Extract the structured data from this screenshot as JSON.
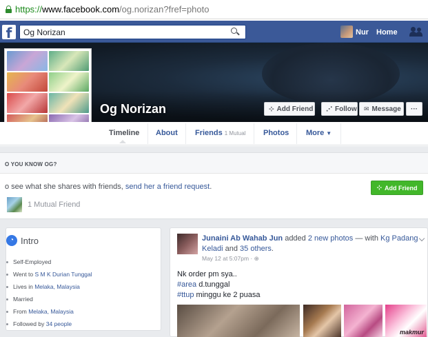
{
  "browser": {
    "url_scheme": "https://",
    "url_host": "www.facebook.com",
    "url_path": "/og.norizan?fref=photo"
  },
  "topbar": {
    "logo": "f",
    "search_value": "Og Norizan",
    "user_name": "Nur",
    "home_label": "Home"
  },
  "profile": {
    "name": "Og Norizan",
    "buttons": {
      "add_friend": "Add Friend",
      "follow": "Follow",
      "message": "Message",
      "more": "···"
    }
  },
  "tabs": {
    "timeline": "Timeline",
    "about": "About",
    "friends": "Friends",
    "friends_sub": "1 Mutual",
    "photos": "Photos",
    "more": "More"
  },
  "know_box": {
    "title": "O YOU KNOW OG?",
    "text_before": "o see what she shares with friends, ",
    "text_link": "send her a friend request",
    "text_after": ".",
    "add_friend": "Add Friend",
    "mutual": "1 Mutual Friend"
  },
  "intro": {
    "title": "Intro",
    "items": [
      {
        "pre": "Self-Employed",
        "link": "",
        "post": ""
      },
      {
        "pre": "Went to ",
        "link": "S M K Durian Tunggal",
        "post": ""
      },
      {
        "pre": "Lives in ",
        "link": "Melaka, Malaysia",
        "post": ""
      },
      {
        "pre": "Married",
        "link": "",
        "post": ""
      },
      {
        "pre": "From ",
        "link": "Melaka, Malaysia",
        "post": ""
      },
      {
        "pre": "Followed by ",
        "link": "34 people",
        "post": ""
      }
    ]
  },
  "post": {
    "author": "Junaini Ab Wahab Jun",
    "action_before": " added ",
    "action_link": "2 new photos",
    "action_mid": " — with ",
    "with_link": "Kg Padang Keladi",
    "action_and": " and ",
    "others_link": "35 others",
    "action_end": ".",
    "meta": "May 12 at 5:07pm · ",
    "line1": "Nk order pm sya..",
    "line2_tag": "#area",
    "line2_rest": " d.tunggal",
    "line3_tag": "#ttup",
    "line3_rest": " minggu ke 2 puasa",
    "watermark": "makmur"
  },
  "colors": {
    "fb_blue": "#3b5998",
    "link": "#365899",
    "green": "#42b72a",
    "page_bg": "#e9ebee"
  }
}
